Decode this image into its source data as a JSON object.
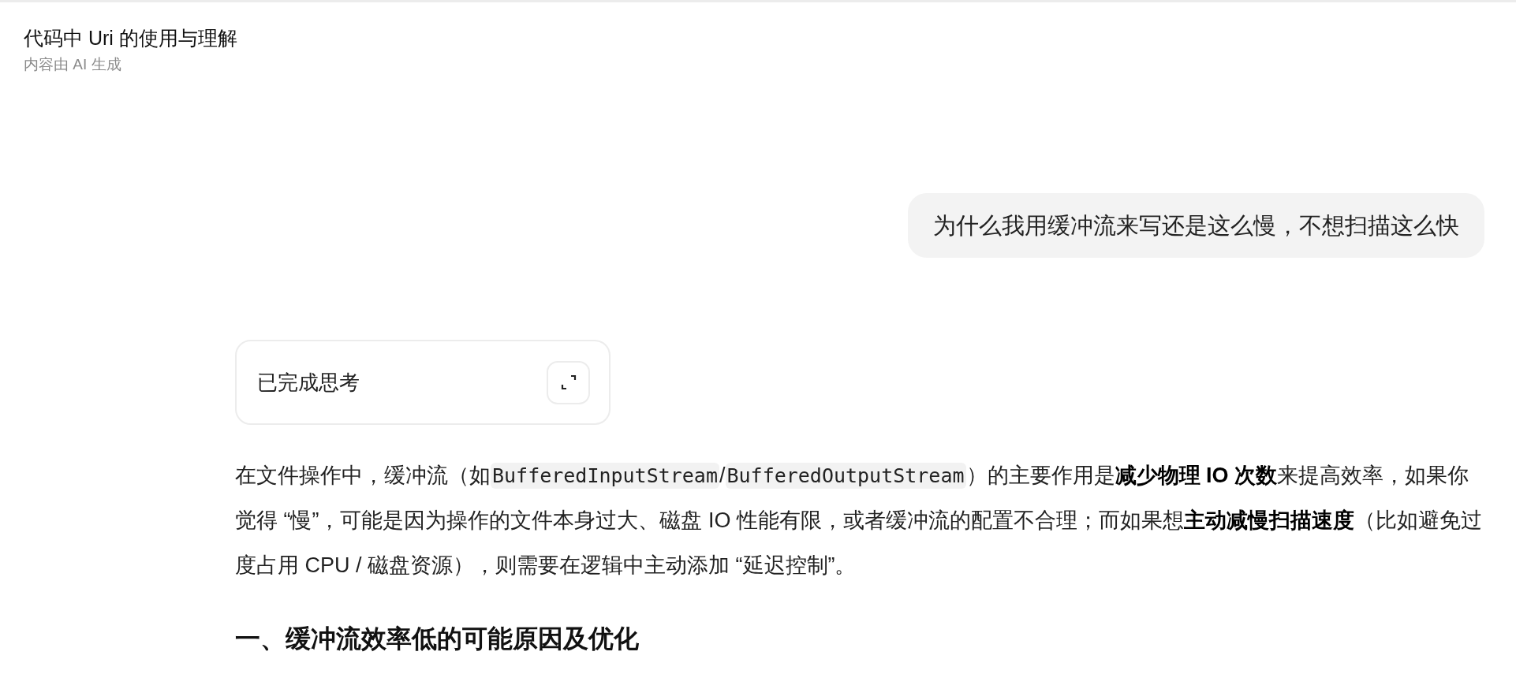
{
  "header": {
    "title": "代码中 Uri 的使用与理解",
    "subtitle": "内容由 AI 生成"
  },
  "user_message": {
    "text": "为什么我用缓冲流来写还是这么慢，不想扫描这么快"
  },
  "thinking": {
    "label": "已完成思考",
    "expanded": false
  },
  "answer": {
    "paragraph": [
      {
        "kind": "text",
        "text": "在文件操作中，缓冲流（如"
      },
      {
        "kind": "code",
        "text": "BufferedInputStream"
      },
      {
        "kind": "text",
        "text": "/"
      },
      {
        "kind": "code",
        "text": "BufferedOutputStream"
      },
      {
        "kind": "text",
        "text": "）的主要作用是"
      },
      {
        "kind": "bold",
        "text": "减少物理 IO 次数"
      },
      {
        "kind": "text",
        "text": "来提高效率，如果你觉得 “慢”，可能是因为操作的文件本身过大、磁盘 IO 性能有限，或者缓冲流的配置不合理；而如果想"
      },
      {
        "kind": "bold",
        "text": "主动减慢扫描速度"
      },
      {
        "kind": "text",
        "text": "（比如避免过度占用 CPU / 磁盘资源），则需要在逻辑中主动添加 “延迟控制”。"
      }
    ],
    "heading": "一、缓冲流效率低的可能原因及优化"
  }
}
